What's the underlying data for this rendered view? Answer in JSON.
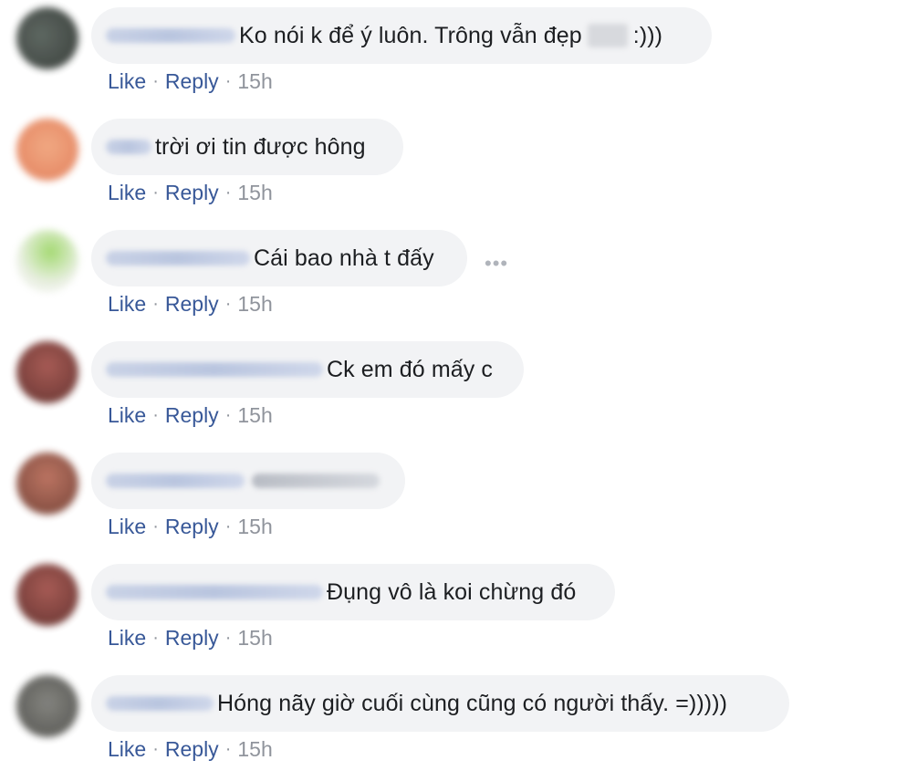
{
  "actions": {
    "like": "Like",
    "reply": "Reply",
    "dot": "·"
  },
  "more_glyph": "•••",
  "comments": [
    {
      "text": "Ko nói k để ý luôn. Trông vẫn đẹp",
      "suffix": ":)))",
      "time": "15h"
    },
    {
      "text": "trời ơi tin được hông",
      "time": "15h"
    },
    {
      "text": "Cái bao nhà t đấy",
      "time": "15h"
    },
    {
      "text": "Ck em đó mấy c",
      "time": "15h"
    },
    {
      "text": "",
      "time": "15h"
    },
    {
      "text": "Đụng vô là koi chừng đó",
      "time": "15h"
    },
    {
      "text": "Hóng nãy giờ cuối cùng cũng có người thấy. =)))))",
      "time": "15h"
    }
  ],
  "colors": {
    "link": "#385898",
    "meta": "#90949c",
    "bubble": "#f2f3f5",
    "text": "#1c1e21"
  }
}
